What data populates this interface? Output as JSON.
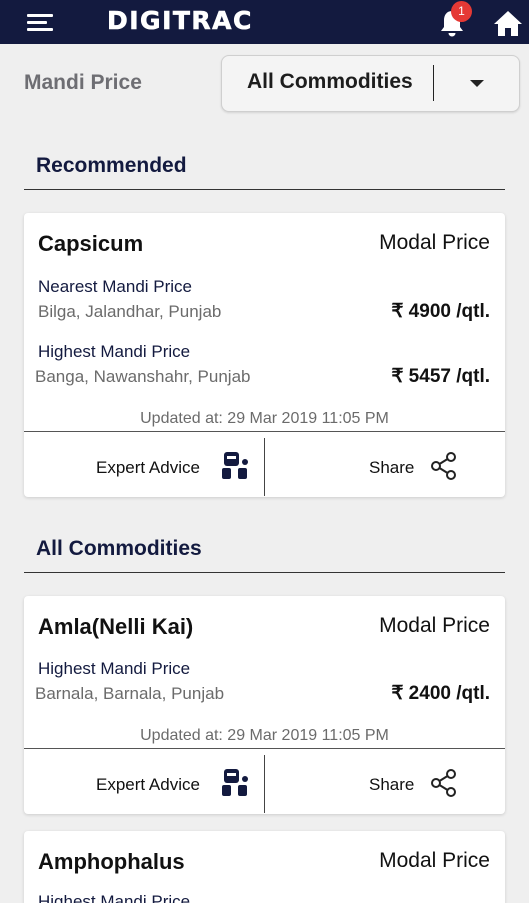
{
  "header": {
    "brand": "DIGITRAC",
    "notification_count": "1",
    "menu_icon": "hamburger-menu-icon",
    "bell_icon": "bell-icon",
    "home_icon": "home-icon",
    "bar_color": "#131a3f",
    "badge_color": "#e53935"
  },
  "filter": {
    "title": "Mandi Price",
    "selected": "All Commodities"
  },
  "recommended": {
    "title": "Recommended",
    "card": {
      "crop": "Capsicum",
      "modal_label": "Modal Price",
      "nearest_label": "Nearest Mandi Price",
      "nearest_location": "Bilga, Jalandhar, Punjab",
      "nearest_price": "₹ 4900 /qtl.",
      "highest_label": "Highest Mandi Price",
      "highest_location": "Banga, Nawanshahr, Punjab",
      "highest_price": "₹ 5457 /qtl.",
      "updated": "Updated at: 29 Mar 2019 11:05 PM",
      "expert_label": "Expert Advice",
      "share_label": "Share"
    }
  },
  "all_commodities": {
    "title": "All Commodities",
    "cards": [
      {
        "crop": "Amla(Nelli Kai)",
        "modal_label": "Modal Price",
        "highest_label": "Highest Mandi Price",
        "highest_location": "Barnala, Barnala, Punjab",
        "highest_price": "₹ 2400 /qtl.",
        "updated": "Updated at: 29 Mar 2019 11:05 PM",
        "expert_label": "Expert Advice",
        "share_label": "Share"
      },
      {
        "crop": "Amphophalus",
        "modal_label": "Modal Price",
        "highest_label": "Highest Mandi Price"
      }
    ]
  }
}
